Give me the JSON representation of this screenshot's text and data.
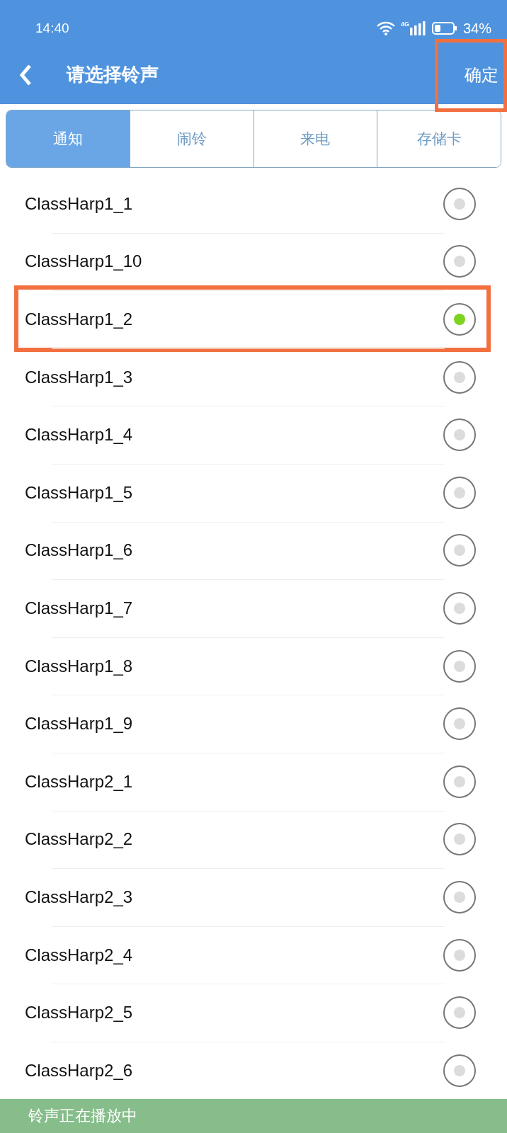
{
  "status_bar": {
    "time": "14:40",
    "network": "4G",
    "battery": "34%"
  },
  "header": {
    "title": "请选择铃声",
    "confirm": {
      "label": "确定",
      "highlighted": true
    }
  },
  "tabs": [
    {
      "label": "通知",
      "selected": true
    },
    {
      "label": "闹铃",
      "selected": false
    },
    {
      "label": "来电",
      "selected": false
    },
    {
      "label": "存储卡",
      "selected": false
    }
  ],
  "ringtones": [
    {
      "name": "ClassHarp1_1",
      "selected": false,
      "highlighted": false
    },
    {
      "name": "ClassHarp1_10",
      "selected": false,
      "highlighted": false
    },
    {
      "name": "ClassHarp1_2",
      "selected": true,
      "highlighted": true
    },
    {
      "name": "ClassHarp1_3",
      "selected": false,
      "highlighted": false
    },
    {
      "name": "ClassHarp1_4",
      "selected": false,
      "highlighted": false
    },
    {
      "name": "ClassHarp1_5",
      "selected": false,
      "highlighted": false
    },
    {
      "name": "ClassHarp1_6",
      "selected": false,
      "highlighted": false
    },
    {
      "name": "ClassHarp1_7",
      "selected": false,
      "highlighted": false
    },
    {
      "name": "ClassHarp1_8",
      "selected": false,
      "highlighted": false
    },
    {
      "name": "ClassHarp1_9",
      "selected": false,
      "highlighted": false
    },
    {
      "name": "ClassHarp2_1",
      "selected": false,
      "highlighted": false
    },
    {
      "name": "ClassHarp2_2",
      "selected": false,
      "highlighted": false
    },
    {
      "name": "ClassHarp2_3",
      "selected": false,
      "highlighted": false
    },
    {
      "name": "ClassHarp2_4",
      "selected": false,
      "highlighted": false
    },
    {
      "name": "ClassHarp2_5",
      "selected": false,
      "highlighted": false
    },
    {
      "name": "ClassHarp2_6",
      "selected": false,
      "highlighted": false
    }
  ],
  "toast": "铃声正在播放中"
}
